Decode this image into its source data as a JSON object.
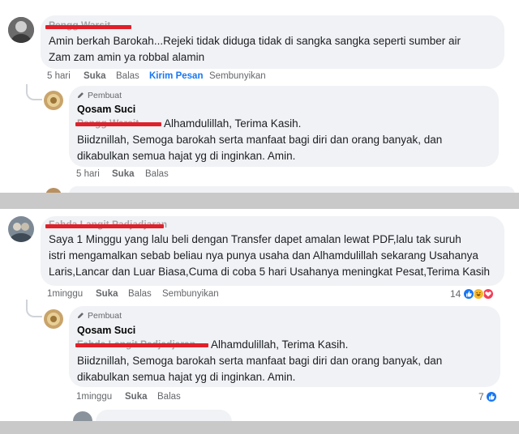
{
  "top": {
    "comment": {
      "line1": "Amin berkah Barokah...Rejeki tidak diduga tidak di sangka sangka seperti sumber air",
      "line2": "Zam zam amin ya robbal alamin",
      "time": "5 hari",
      "like": "Suka",
      "reply": "Balas",
      "send_message": "Kirim Pesan",
      "hide": "Sembunyikan"
    },
    "reply": {
      "badge": "Pembuat",
      "author": "Qosam Suci",
      "line1": "Alhamdulillah, Terima Kasih.",
      "line2": "Biidznillah, Semoga barokah serta manfaat bagi diri dan orang banyak, dan",
      "line3": "dikabulkan semua hajat yg di inginkan. Amin.",
      "time": "5 hari",
      "like": "Suka",
      "reply": "Balas"
    }
  },
  "bottom": {
    "comment": {
      "line1": "Saya 1 Minggu yang lalu beli dengan Transfer dapet amalan lewat PDF,lalu tak suruh",
      "line2": "istri mengamalkan sebab beliau nya punya usaha dan Alhamdulillah sekarang Usahanya",
      "line3": "Laris,Lancar dan Luar Biasa,Cuma di coba 5 hari Usahanya meningkat Pesat,Terima Kasih",
      "time": "1minggu",
      "like": "Suka",
      "reply": "Balas",
      "hide": "Sembunyikan",
      "reaction_count": "14"
    },
    "reply": {
      "badge": "Pembuat",
      "author": "Qosam Suci",
      "line1": "Alhamdulillah, Terima Kasih.",
      "line2": "Biidznillah, Semoga barokah serta manfaat bagi diri dan orang banyak, dan",
      "line3": "dikabulkan semua hajat yg di inginkan. Amin.",
      "time": "1minggu",
      "like": "Suka",
      "reply": "Balas",
      "reaction_count": "7"
    }
  },
  "colors": {
    "redaction": "#e0202a",
    "bubble": "#f0f2f5",
    "link_blue": "#1877f2",
    "divider": "#c9c9c9"
  },
  "icons": [
    "pencil-icon",
    "like-reaction-icon",
    "haha-reaction-icon",
    "love-reaction-icon"
  ]
}
